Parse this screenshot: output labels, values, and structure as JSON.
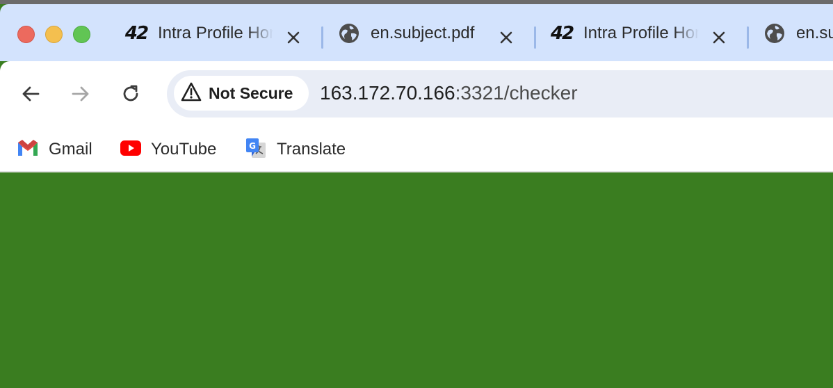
{
  "window": {
    "traffic_lights": [
      {
        "name": "close",
        "color": "#ec6a5e"
      },
      {
        "name": "minimize",
        "color": "#f4bf4f"
      },
      {
        "name": "maximize",
        "color": "#61c554"
      }
    ]
  },
  "tabs": [
    {
      "title": "Intra Profile Home",
      "favicon": "42-logo-icon",
      "close_label": "close-tab"
    },
    {
      "title": "en.subject.pdf",
      "favicon": "globe-icon",
      "close_label": "close-tab"
    },
    {
      "title": "Intra Profile Home",
      "favicon": "42-logo-icon",
      "close_label": "close-tab"
    },
    {
      "title": "en.subject.pdf",
      "favicon": "globe-icon"
    }
  ],
  "toolbar": {
    "back_icon": "arrow-left-icon",
    "forward_icon": "arrow-right-icon",
    "reload_icon": "reload-icon",
    "security_label": "Not Secure",
    "url_host": "163.172.70.166",
    "url_rest": ":3321/checker"
  },
  "bookmarks": [
    {
      "label": "Gmail",
      "icon": "gmail-icon"
    },
    {
      "label": "YouTube",
      "icon": "youtube-icon"
    },
    {
      "label": "Translate",
      "icon": "google-translate-icon"
    }
  ],
  "content": {
    "background_color": "#3a7d20"
  }
}
